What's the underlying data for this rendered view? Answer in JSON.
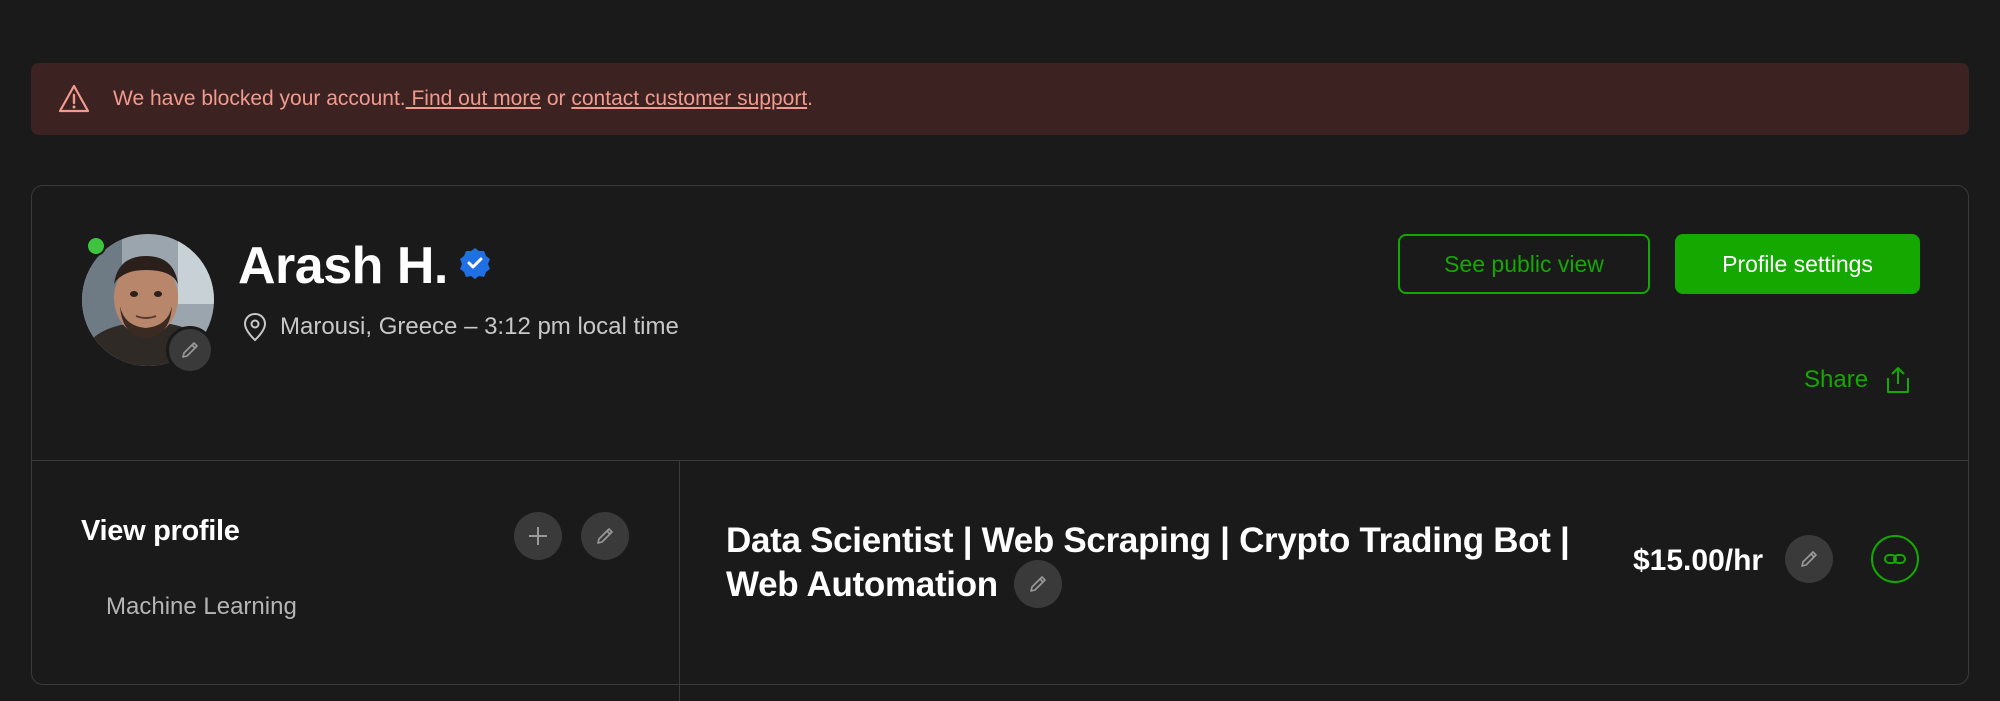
{
  "alert": {
    "text_before": "We have blocked your account.",
    "link1": " Find out more",
    "text_mid": " or ",
    "link2": "contact customer support",
    "text_after": "."
  },
  "profile": {
    "name": "Arash H.",
    "location": "Marousi, Greece – 3:12 pm local time",
    "online": true,
    "verified": true
  },
  "actions": {
    "see_public_view": "See public view",
    "profile_settings": "Profile settings",
    "share": "Share"
  },
  "sidebar": {
    "heading": "View profile",
    "skills": [
      "Machine Learning"
    ]
  },
  "main": {
    "title": "Data Scientist | Web Scraping | Crypto Trading Bot | Web Automation",
    "rate": "$15.00/hr"
  },
  "colors": {
    "accent_green": "#14a800",
    "alert_bg": "#3d2222",
    "alert_text": "#f19a8e",
    "verified_blue": "#1f6fe5"
  },
  "icons": {
    "alert": "warning-triangle-icon",
    "verified": "verified-badge-icon",
    "location": "location-pin-icon",
    "share": "share-upload-icon",
    "add": "plus-icon",
    "edit": "pencil-icon",
    "link": "link-icon"
  }
}
